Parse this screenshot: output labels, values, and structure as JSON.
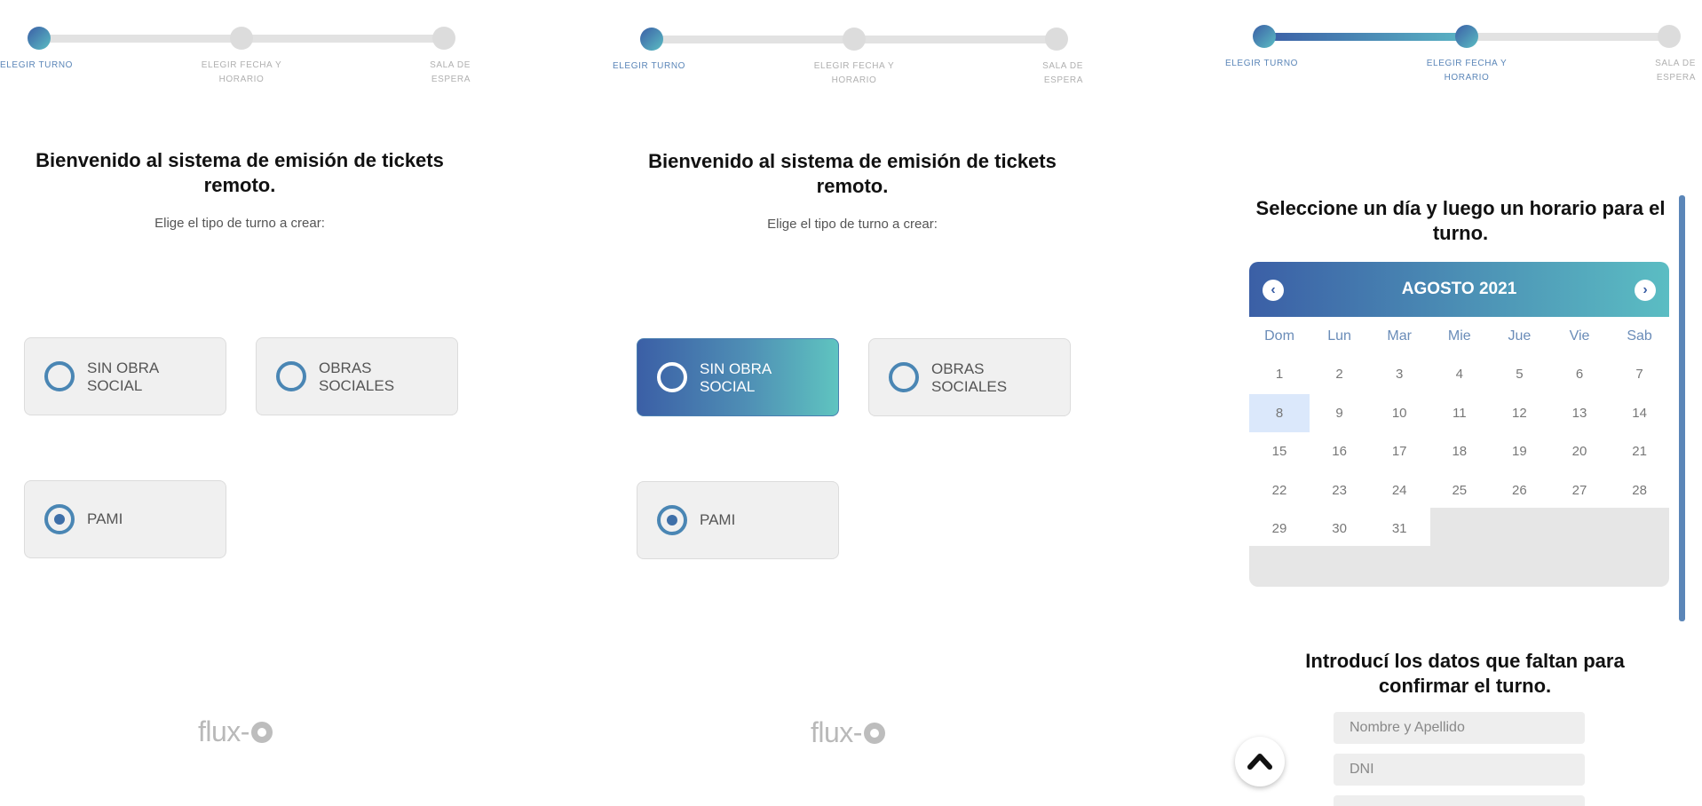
{
  "steps": [
    "ELEGIR TURNO",
    "ELEGIR FECHA Y HORARIO",
    "SALA DE ESPERA"
  ],
  "welcome": {
    "title": "Bienvenido al sistema de emisión de tickets remoto.",
    "subtitle": "Elige el tipo de turno a crear:"
  },
  "options": {
    "sin_obra_social": "SIN OBRA SOCIAL",
    "obras_sociales": "OBRAS SOCIALES",
    "pami": "PAMI"
  },
  "logo": "flux-",
  "calendar": {
    "heading": "Seleccione un día y luego un horario para el turno.",
    "month": "AGOSTO 2021",
    "weekdays": [
      "Dom",
      "Lun",
      "Mar",
      "Mie",
      "Jue",
      "Vie",
      "Sab"
    ],
    "days": [
      "1",
      "2",
      "3",
      "4",
      "5",
      "6",
      "7",
      "8",
      "9",
      "10",
      "11",
      "12",
      "13",
      "14",
      "15",
      "16",
      "17",
      "18",
      "19",
      "20",
      "21",
      "22",
      "23",
      "24",
      "25",
      "26",
      "27",
      "28",
      "29",
      "30",
      "31"
    ],
    "selected_day": "8",
    "prev_icon": "chevron-left-icon",
    "next_icon": "chevron-right-icon"
  },
  "form": {
    "heading": "Introducí los datos que faltan para confirmar el turno.",
    "name_placeholder": "Nombre y Apellido",
    "dni_placeholder": "DNI"
  },
  "colors": {
    "accent_start": "#3b5fa6",
    "accent_end": "#5bbdc3",
    "today_bg": "#dbe8fb"
  }
}
